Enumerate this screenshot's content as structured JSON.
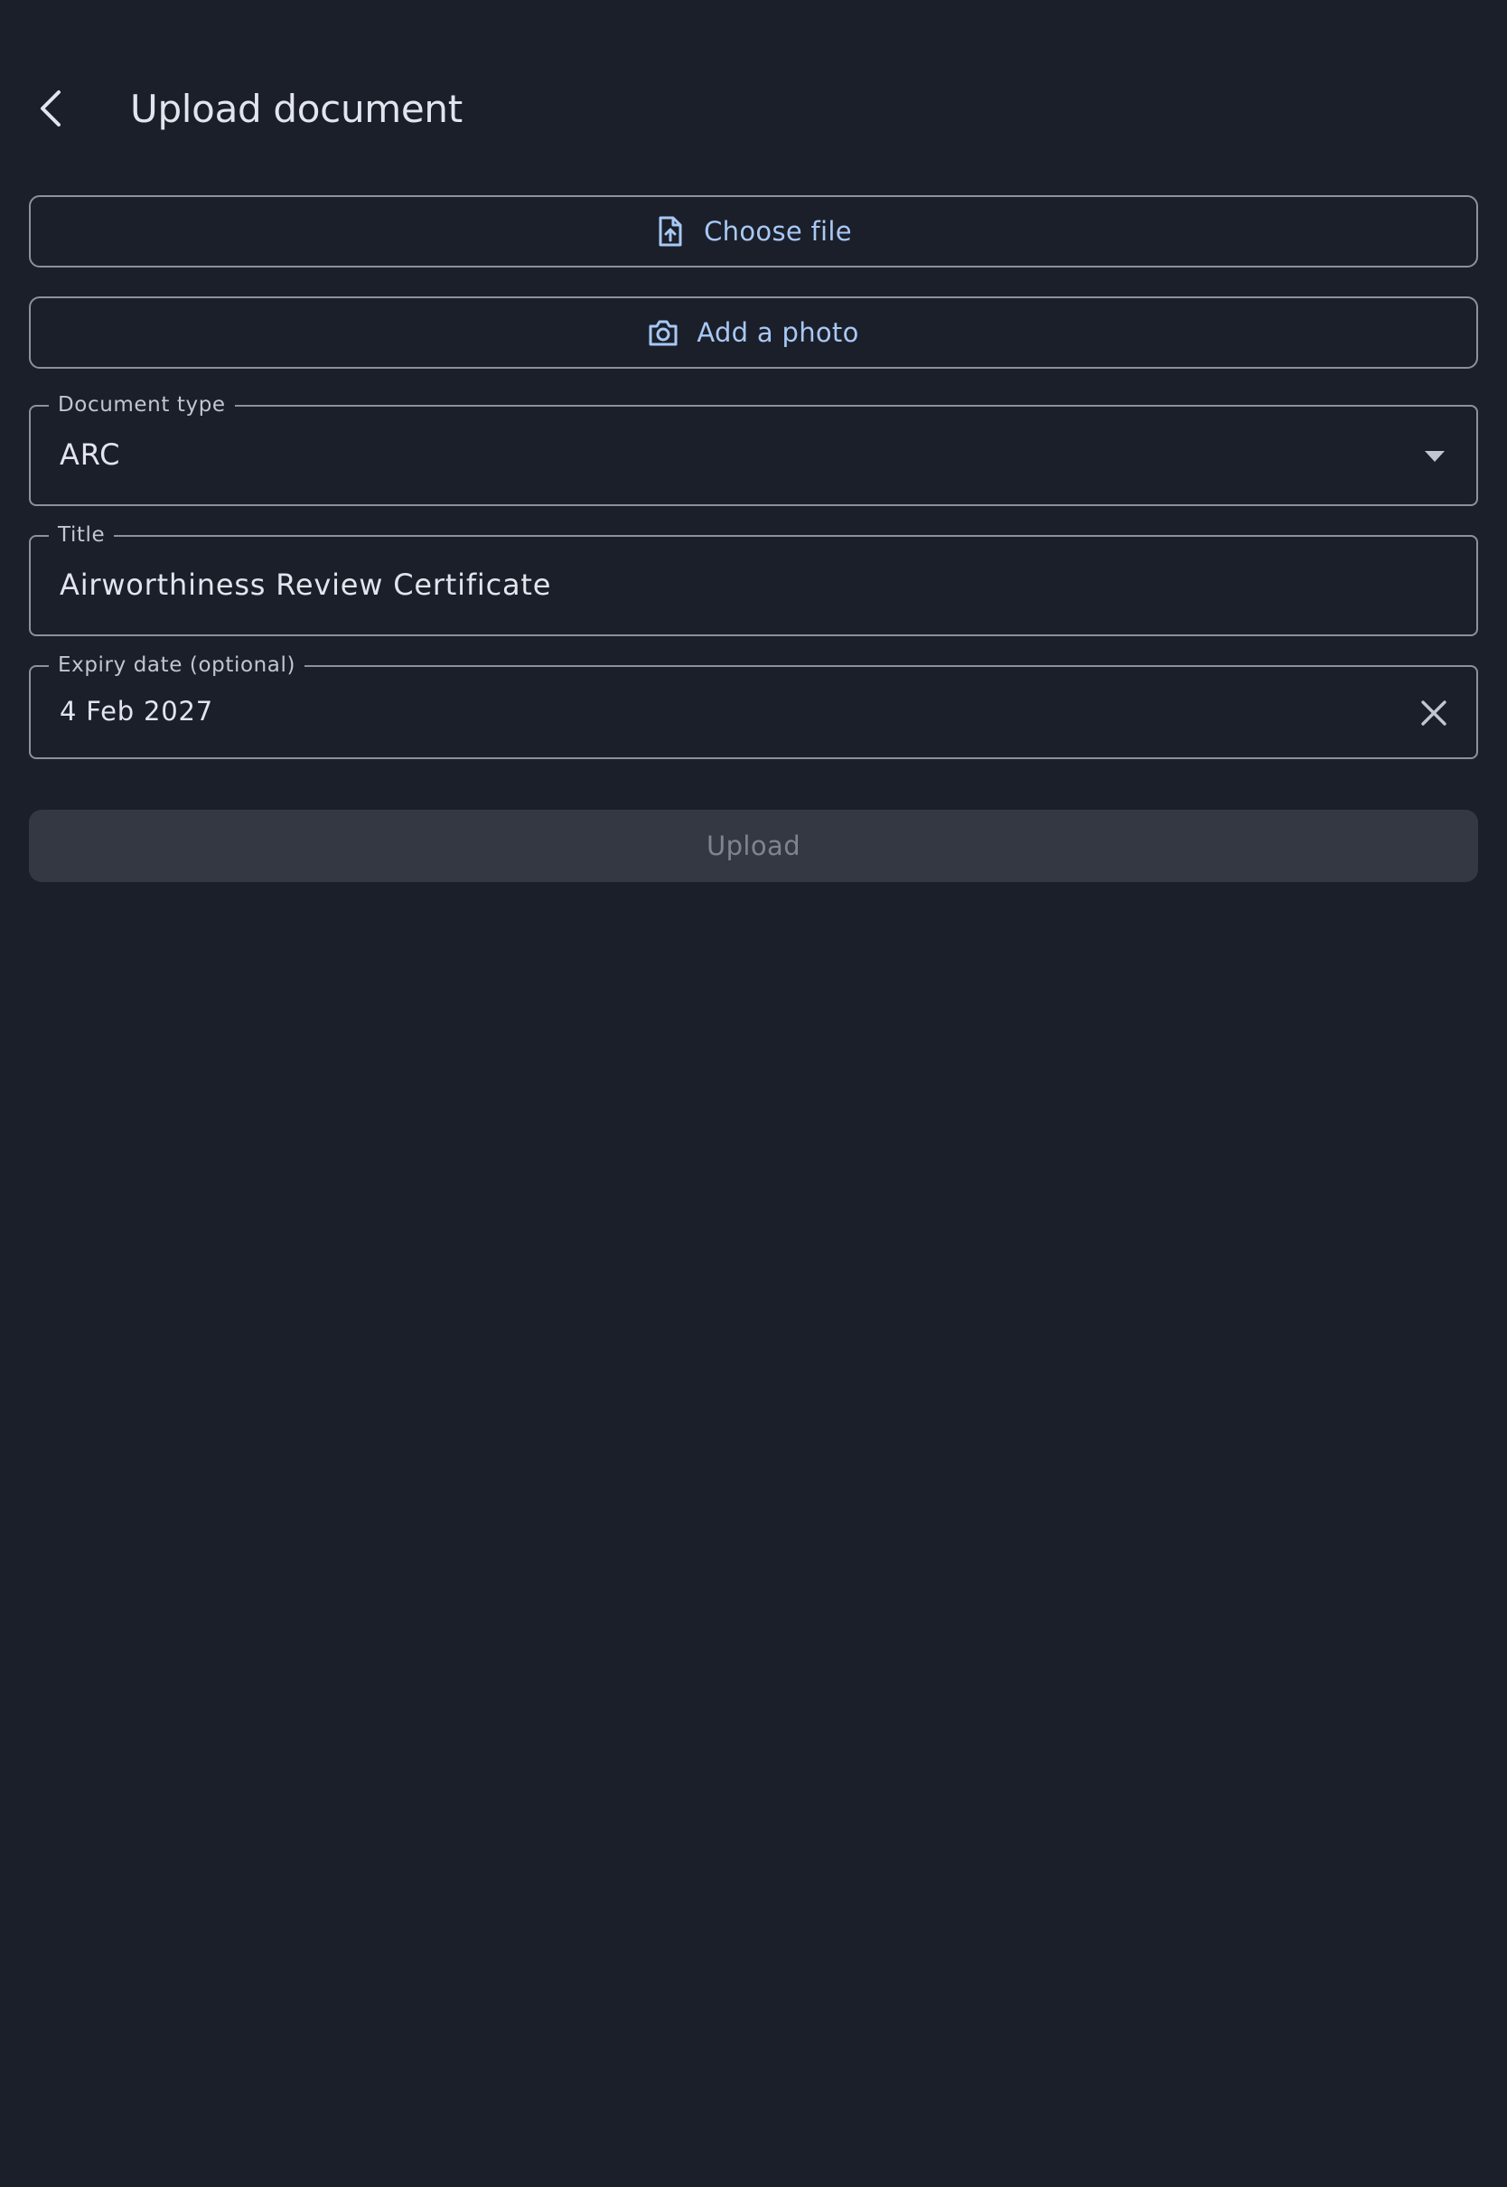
{
  "header": {
    "title": "Upload document",
    "back_icon": "chevron-left-icon"
  },
  "actions": {
    "choose_file_label": "Choose file",
    "choose_file_icon": "file-upload-icon",
    "add_photo_label": "Add a photo",
    "add_photo_icon": "camera-icon"
  },
  "form": {
    "document_type": {
      "label": "Document type",
      "value": "ARC",
      "icon": "dropdown-arrow-icon"
    },
    "title": {
      "label": "Title",
      "value": "Airworthiness Review Certificate"
    },
    "expiry_date": {
      "label": "Expiry date (optional)",
      "value": "4 Feb 2027",
      "clear_icon": "close-icon"
    }
  },
  "submit": {
    "label": "Upload",
    "disabled": true
  },
  "colors": {
    "background": "#1b1f29",
    "accent": "#a8c8f5",
    "outline": "#8d919c",
    "text": "#e2e5ee",
    "disabled_bg": "#343843",
    "disabled_text": "#80848e"
  }
}
